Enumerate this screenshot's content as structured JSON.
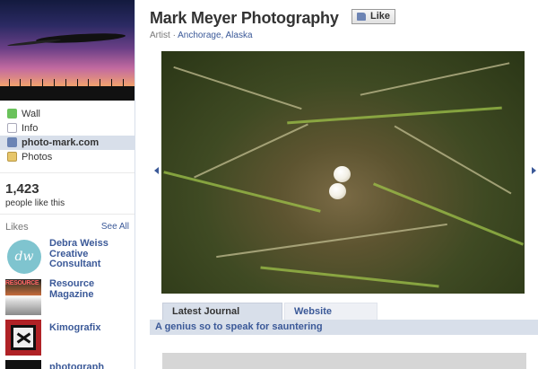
{
  "sidebar": {
    "nav": [
      {
        "label": "Wall",
        "icon": "wall-icon"
      },
      {
        "label": "Info",
        "icon": "info-icon"
      },
      {
        "label": "photo-mark.com",
        "icon": "link-icon",
        "active": true
      },
      {
        "label": "Photos",
        "icon": "photos-icon"
      }
    ],
    "likes_count": "1,423",
    "likes_text": "people like this",
    "likes_heading": "Likes",
    "see_all": "See All",
    "liked_pages": [
      {
        "name": "Debra Weiss Creative Consultant",
        "thumb": "dw"
      },
      {
        "name": "Resource Magazine",
        "thumb": "resource"
      },
      {
        "name": "Kimografix",
        "thumb": "kimografix"
      },
      {
        "name": "photograph",
        "thumb": "photograph"
      }
    ]
  },
  "header": {
    "title": "Mark Meyer Photography",
    "like_button": "Like",
    "category": "Artist",
    "separator": "·",
    "location": "Anchorage, Alaska"
  },
  "tabs": [
    {
      "label": "Latest Journal Entries",
      "active": true
    },
    {
      "label": "Website Galleries",
      "active": false
    }
  ],
  "journal": {
    "entry_title": "A genius so to speak for sauntering"
  },
  "colors": {
    "link": "#3b5998",
    "nav_active": "#d8dfea"
  }
}
